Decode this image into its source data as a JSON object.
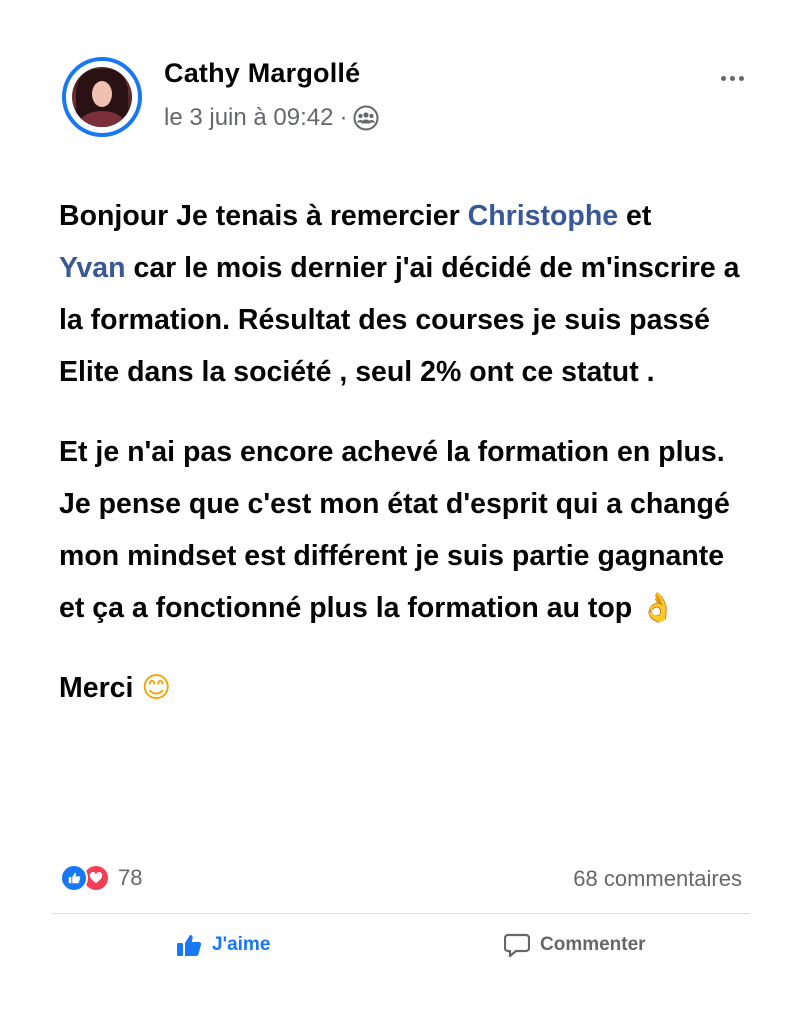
{
  "post": {
    "author": "Cathy Margollé",
    "date": "le 3 juin à 09:42",
    "date_separator": "·",
    "audience_icon": "group-icon",
    "more_icon": "more-options-icon",
    "paragraph1": {
      "t1": "Bonjour Je tenais à remercier ",
      "mention1": "Christophe",
      "t2": " et",
      "mention2": "Yvan",
      "t3": " car le mois dernier j'ai décidé de m'inscrire a la formation. Résultat des courses je suis passé Elite dans la société , seul 2% ont ce statut ."
    },
    "paragraph2": {
      "text": "Et je n'ai pas encore achevé la formation en plus. Je pense que c'est mon état d'esprit qui a changé mon mindset est différent je suis partie gagnante et ça a fonctionné plus la formation au top ",
      "emoji": "👌"
    },
    "paragraph3": {
      "text": "Merci ",
      "emoji": "😊"
    }
  },
  "reactions": {
    "count": "78",
    "types": [
      "like-reaction-icon",
      "love-reaction-icon"
    ],
    "comments": "68 commentaires"
  },
  "actions": {
    "like_label": "J'aime",
    "comment_label": "Commenter"
  },
  "colors": {
    "accent": "#1877f2",
    "mention": "#385898",
    "love": "#f33e58",
    "secondary_text": "#65676b"
  }
}
